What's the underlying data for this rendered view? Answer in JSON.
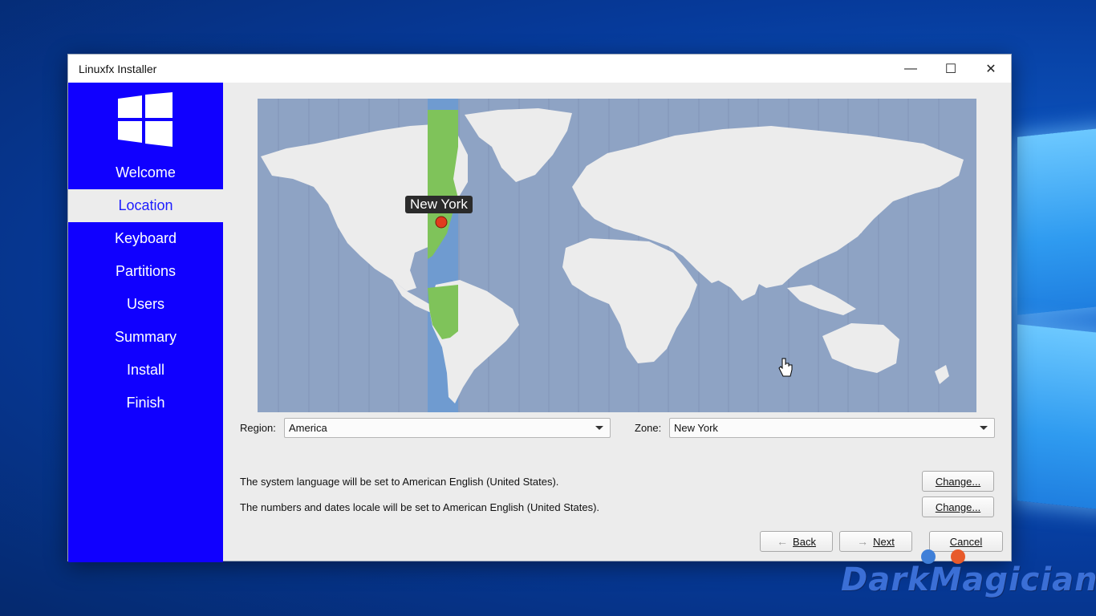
{
  "window": {
    "title": "Linuxfx Installer"
  },
  "window_controls": {
    "minimize": "—",
    "maximize": "☐",
    "close": "✕"
  },
  "sidebar": {
    "items": [
      {
        "label": "Welcome"
      },
      {
        "label": "Location",
        "active": true
      },
      {
        "label": "Keyboard"
      },
      {
        "label": "Partitions"
      },
      {
        "label": "Users"
      },
      {
        "label": "Summary"
      },
      {
        "label": "Install"
      },
      {
        "label": "Finish"
      }
    ]
  },
  "map": {
    "selected_city": "New York"
  },
  "region": {
    "label": "Region:",
    "value": "America"
  },
  "zone": {
    "label": "Zone:",
    "value": "New York"
  },
  "language": {
    "text": "The system language will be set to American English (United States).",
    "button": "Change..."
  },
  "locale": {
    "text": "The numbers and dates locale will be set to American English (United States).",
    "button": "Change..."
  },
  "buttons": {
    "back": "Back",
    "next": "Next",
    "cancel": "Cancel"
  },
  "colors": {
    "sidebar": "#1000ff",
    "sidebar_active_text": "#1d1dff",
    "map_sea": "#8ea3c4",
    "timezone_band": "#6f9bd0",
    "highlight_land": "#7fc35a"
  },
  "watermark": {
    "text": "DarkMagician"
  }
}
